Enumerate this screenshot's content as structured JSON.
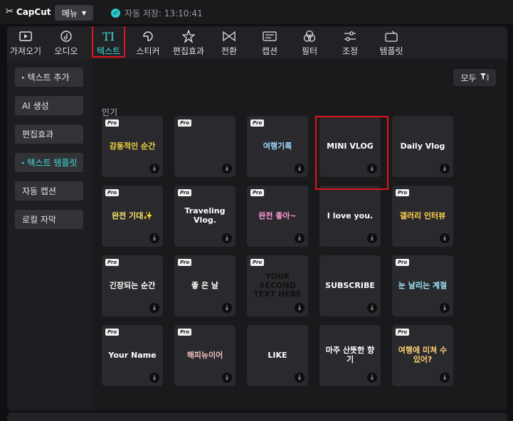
{
  "app": {
    "logo": "CapCut",
    "menu_label": "메뉴",
    "autosave_text": "자동 저장: 13:10:41"
  },
  "tabs": [
    {
      "label": "가져오기",
      "icon": "import-icon"
    },
    {
      "label": "오디오",
      "icon": "audio-icon"
    },
    {
      "label": "텍스트",
      "icon": "text-icon",
      "active": true
    },
    {
      "label": "스티커",
      "icon": "sticker-icon"
    },
    {
      "label": "편집효과",
      "icon": "effects-icon"
    },
    {
      "label": "전환",
      "icon": "transition-icon"
    },
    {
      "label": "캡션",
      "icon": "caption-icon"
    },
    {
      "label": "필터",
      "icon": "filter-icon"
    },
    {
      "label": "조정",
      "icon": "adjust-icon"
    },
    {
      "label": "템플릿",
      "icon": "template-icon"
    }
  ],
  "sidebar": {
    "items": [
      {
        "label": "텍스트 추가",
        "arrow": "▸"
      },
      {
        "label": "AI 생성"
      },
      {
        "label": "편집효과"
      },
      {
        "label": "텍스트 템플릿",
        "arrow": "▸",
        "active": true
      },
      {
        "label": "자동 캡션"
      },
      {
        "label": "로컬 자막"
      }
    ]
  },
  "content": {
    "filter_label": "모두",
    "section_title": "인기",
    "pro_badge": "Pro",
    "cards": [
      {
        "text": "감동적인 순간",
        "pro": true,
        "color": "#f2d640"
      },
      {
        "text": "",
        "pro": true,
        "color": "#ffffff"
      },
      {
        "text": "여행기록",
        "pro": true,
        "color": "#9fd9ff"
      },
      {
        "text": "MINI VLOG",
        "pro": false,
        "color": "#ffffff"
      },
      {
        "text": "Daily Vlog",
        "pro": false,
        "color": "#ffffff"
      },
      {
        "text": "완전 기대✨",
        "pro": true,
        "color": "#ffe66b"
      },
      {
        "text": "Traveling Vlog.",
        "pro": true,
        "color": "#ffffff"
      },
      {
        "text": "완전 좋아~",
        "pro": true,
        "color": "#ff9ad5"
      },
      {
        "text": "I love you.",
        "pro": false,
        "color": "#ffffff"
      },
      {
        "text": "갤러리 인터뷰",
        "pro": true,
        "color": "#ffd34d"
      },
      {
        "text": "긴장되는 순간",
        "pro": true,
        "color": "#ffffff"
      },
      {
        "text": "좋 은 날",
        "pro": true,
        "color": "#ffffff"
      },
      {
        "text": "YOUR SECOND TEXT HERE",
        "pro": true,
        "color": "#111111"
      },
      {
        "text": "SUBSCRIBE",
        "pro": false,
        "color": "#ffffff"
      },
      {
        "text": "눈 날리는 계절",
        "pro": true,
        "color": "#9fe8ff"
      },
      {
        "text": "Your Name",
        "pro": true,
        "color": "#ffffff"
      },
      {
        "text": "해피뉴이어",
        "pro": true,
        "color": "#f0c0c0"
      },
      {
        "text": "LIKE",
        "pro": false,
        "color": "#ffffff"
      },
      {
        "text": "마주 산뜻한 향기",
        "pro": false,
        "color": "#ffffff"
      },
      {
        "text": "여행에 미쳐 수 있어?",
        "pro": true,
        "color": "#ffd070"
      }
    ]
  }
}
